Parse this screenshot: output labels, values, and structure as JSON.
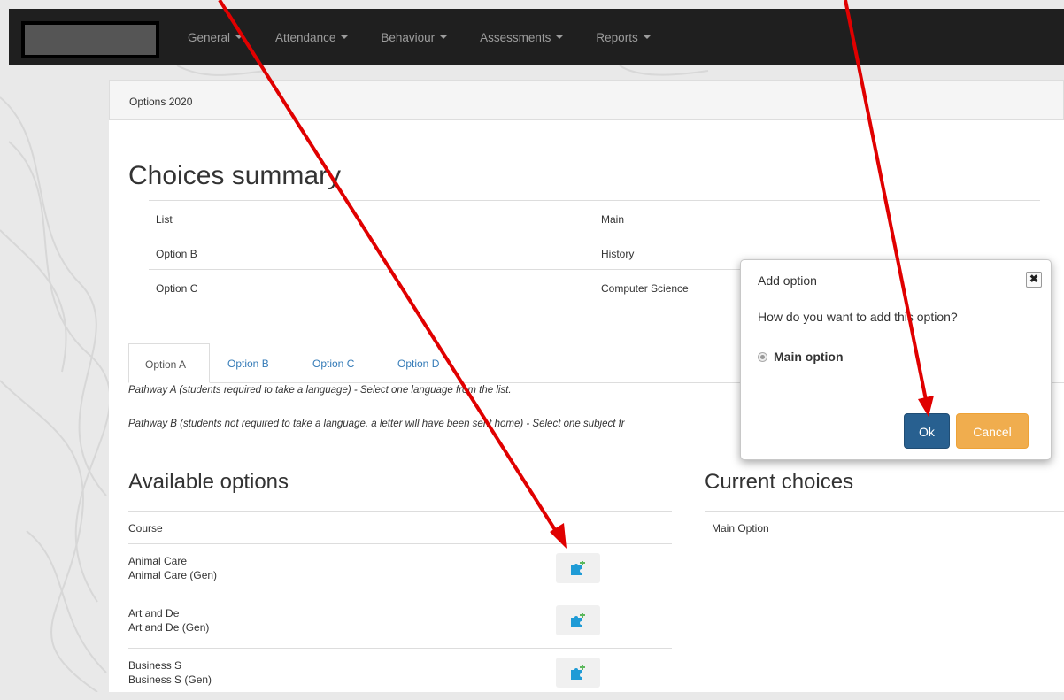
{
  "navbar": {
    "items": [
      {
        "label": "General"
      },
      {
        "label": "Attendance"
      },
      {
        "label": "Behaviour"
      },
      {
        "label": "Assessments"
      },
      {
        "label": "Reports"
      }
    ]
  },
  "panel": {
    "heading": "Options 2020",
    "summary_title": "Choices summary",
    "summary_rows": [
      {
        "list": "List",
        "main": "Main"
      },
      {
        "list": "Option B",
        "main": "History"
      },
      {
        "list": "Option C",
        "main": "Computer Science"
      }
    ],
    "tabs": [
      {
        "label": "Option A"
      },
      {
        "label": "Option B"
      },
      {
        "label": "Option C"
      },
      {
        "label": "Option D"
      }
    ],
    "pathway_a": "Pathway A (students required to take a language) - Select one language from the list.",
    "pathway_b": "Pathway B (students not required to take a language, a letter will have been sent home) - Select one subject fr",
    "available_title": "Available options",
    "available_header": "Course",
    "courses": [
      {
        "name": "Animal Care",
        "sub": "Animal Care (Gen)"
      },
      {
        "name": "Art and De",
        "sub": "Art and De (Gen)"
      },
      {
        "name": "Business S",
        "sub": "Business S (Gen)"
      }
    ],
    "current_title": "Current choices",
    "current_header": "Main Option"
  },
  "modal": {
    "title": "Add option",
    "close": "✖",
    "question": "How do you want to add this option?",
    "radio_label": "Main option",
    "ok": "Ok",
    "cancel": "Cancel"
  },
  "colors": {
    "navbar": "#1f1f1f",
    "link": "#337ab7",
    "ok": "#286090",
    "cancel": "#f0ad4e",
    "annotation_arrow": "#e00000",
    "puzzle_icon": "#1f9bd6",
    "puzzle_plus": "#5cb85c"
  }
}
